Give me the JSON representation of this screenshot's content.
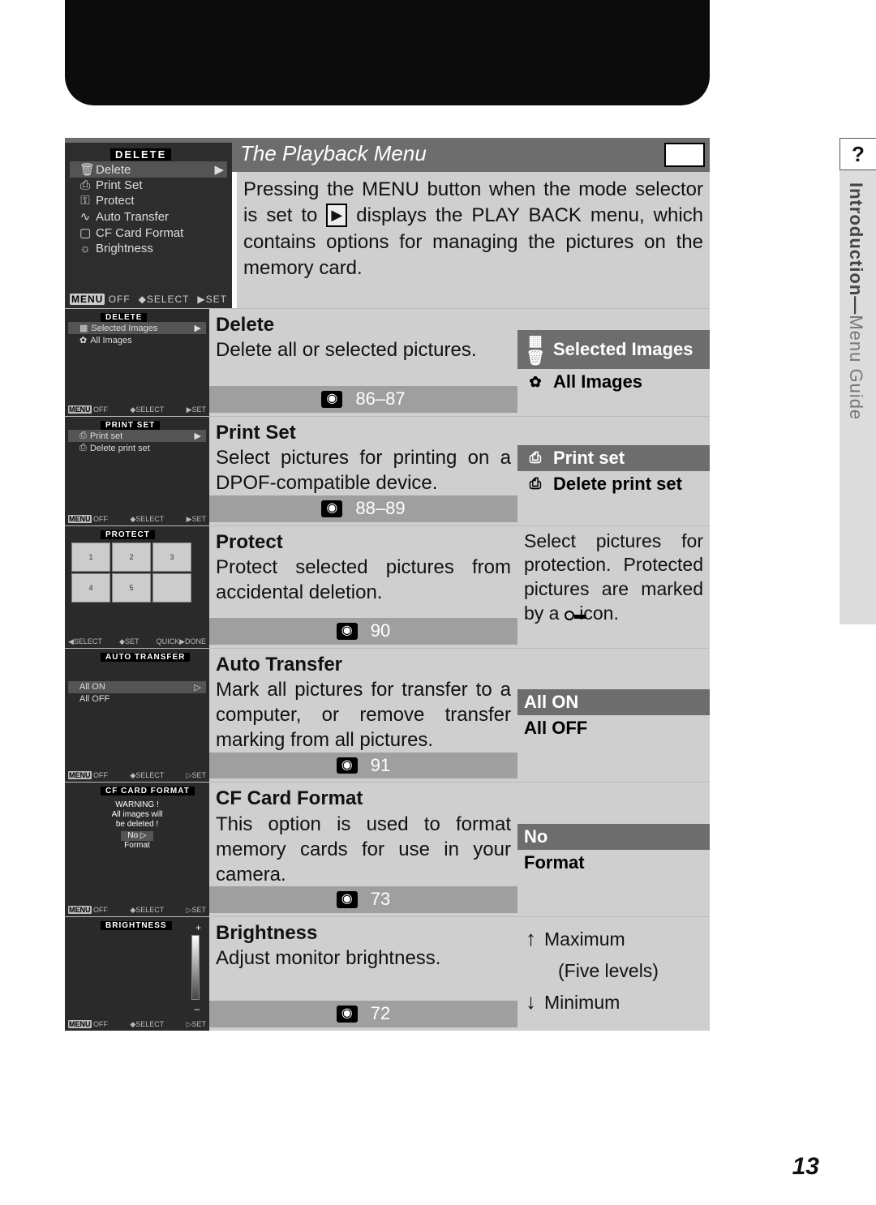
{
  "header": {
    "title": "The Playback Menu",
    "side_section": "Introduction—",
    "side_subsection": "Menu Guide",
    "side_glyph": "?"
  },
  "intro": {
    "part1": "Pressing the MENU button when the mode selector is set to ",
    "part2": " displays the PLAY BACK menu, which contains options for managing the pictures on the memory card."
  },
  "biglcd": {
    "header": "DELETE",
    "items": [
      "Delete",
      "Print Set",
      "Protect",
      "Auto Transfer",
      "CF Card Format",
      "Brightness"
    ],
    "footer": {
      "off": "OFF",
      "select": "SELECT",
      "set": "SET",
      "menu": "MENU"
    }
  },
  "items": [
    {
      "thumb_header": "DELETE",
      "thumb_rows": [
        "Selected Images",
        "All Images"
      ],
      "title": "Delete",
      "desc": "Delete all or selected pictures.",
      "page": "86–87",
      "options": [
        {
          "style": "dark",
          "icon": "▦",
          "label": "Selected Images"
        },
        {
          "style": "light",
          "icon": "✿",
          "label": "All Images"
        }
      ]
    },
    {
      "thumb_header": "PRINT SET",
      "thumb_rows": [
        "Print set",
        "Delete print set"
      ],
      "title": "Print Set",
      "desc": "Select pictures for printing on a DPOF-compatible device.",
      "page": "88–89",
      "options": [
        {
          "style": "dark",
          "icon": "⎙",
          "label": "Print set"
        },
        {
          "style": "light",
          "icon": "⎙",
          "label": "Delete print set"
        }
      ]
    },
    {
      "thumb_header": "PROTECT",
      "title": "Protect",
      "desc": "Protect selected pictures from accidental deletion.",
      "page": "90",
      "right_text_1": "Select pictures for protection. Protected pictures are marked by a ",
      "right_text_2": " icon."
    },
    {
      "thumb_header": "AUTO TRANSFER",
      "thumb_rows": [
        "All ON",
        "All OFF"
      ],
      "title": "Auto Transfer",
      "desc": "Mark all pictures for transfer to a computer, or remove transfer marking from all pictures.",
      "page": "91",
      "options": [
        {
          "style": "dark",
          "icon": "",
          "label": "All ON"
        },
        {
          "style": "light",
          "icon": "",
          "label": "All OFF"
        }
      ]
    },
    {
      "thumb_header": "CF CARD FORMAT",
      "thumb_warn": [
        "WARNING !",
        "All images will",
        "be deleted !",
        "No",
        "Format"
      ],
      "title": "CF Card Format",
      "desc": "This option is used to format memory cards for use in your camera.",
      "page": "73",
      "options": [
        {
          "style": "dark",
          "icon": "",
          "label": "No"
        },
        {
          "style": "light",
          "icon": "",
          "label": "Format"
        }
      ]
    },
    {
      "thumb_header": "BRIGHTNESS",
      "title": "Brightness",
      "desc": "Adjust monitor brightness.",
      "page": "72",
      "bright": {
        "max": "Maximum",
        "levels": "(Five levels)",
        "min": "Minimum"
      }
    }
  ],
  "page_number": "13"
}
